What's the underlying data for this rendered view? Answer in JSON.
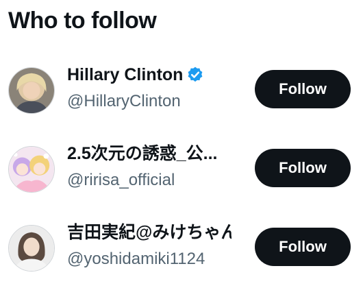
{
  "header": {
    "title": "Who to follow"
  },
  "accounts": [
    {
      "name": "Hillary Clinton",
      "handle": "@HillaryClinton",
      "verified": true,
      "button": "Follow"
    },
    {
      "name": "2.5次元の誘惑_公...",
      "handle": "@ririsa_official",
      "verified": false,
      "button": "Follow"
    },
    {
      "name": "吉田実紀@みけちゃん",
      "handle": "@yoshidamiki1124",
      "verified": false,
      "button": "Follow"
    }
  ],
  "colors": {
    "button_bg": "#0f1419",
    "handle_text": "#536471",
    "verified_blue": "#1d9bf0"
  }
}
